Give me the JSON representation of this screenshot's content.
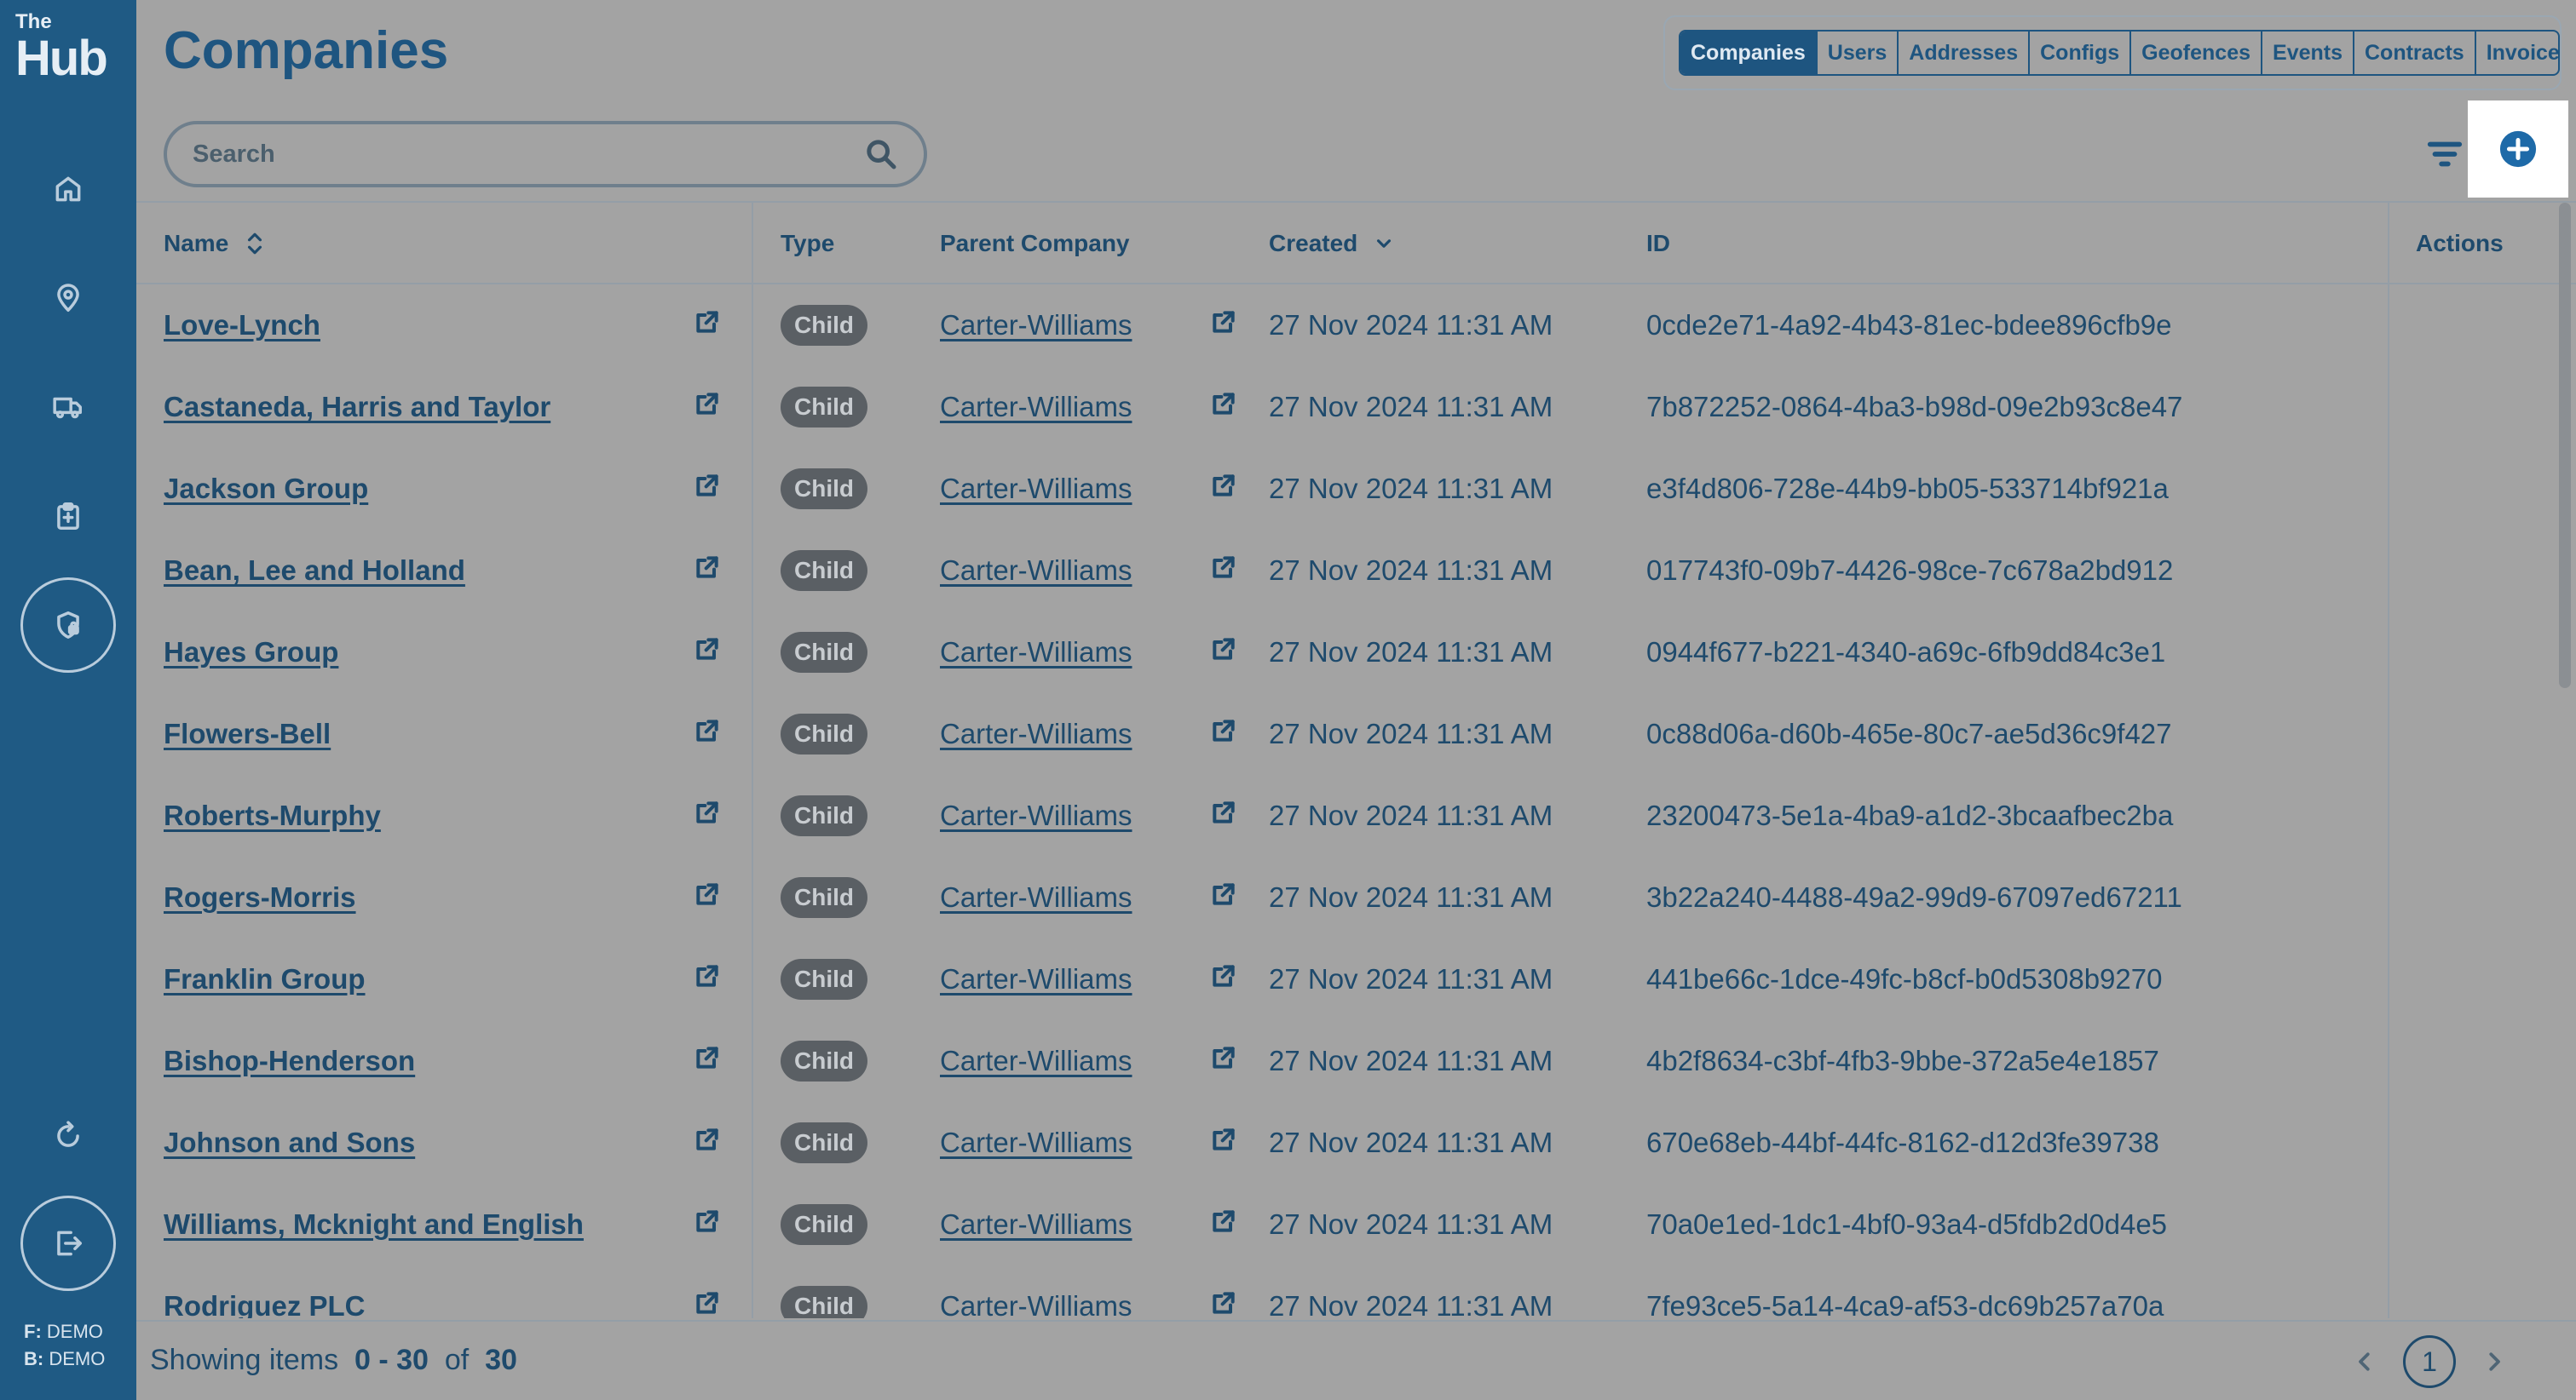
{
  "app": {
    "logo_small": "The",
    "logo_large": "Hub"
  },
  "sidebar": {
    "icons": [
      "home-icon",
      "location-pin-icon",
      "truck-icon",
      "clipboard-icon",
      "shield-lock-icon",
      "refresh-icon",
      "logout-icon"
    ],
    "env_f_label": "F:",
    "env_f_value": "DEMO",
    "env_b_label": "B:",
    "env_b_value": "DEMO"
  },
  "page": {
    "title": "Companies"
  },
  "tabs": [
    "Companies",
    "Users",
    "Addresses",
    "Configs",
    "Geofences",
    "Events",
    "Contracts",
    "Invoices"
  ],
  "active_tab": "Companies",
  "search": {
    "placeholder": "Search",
    "value": ""
  },
  "table": {
    "headers": {
      "name": "Name",
      "type": "Type",
      "parent": "Parent Company",
      "created": "Created",
      "id": "ID",
      "actions": "Actions"
    },
    "rows": [
      {
        "name": "Love-Lynch",
        "type": "Child",
        "parent": "Carter-Williams",
        "created": "27 Nov 2024 11:31 AM",
        "id": "0cde2e71-4a92-4b43-81ec-bdee896cfb9e"
      },
      {
        "name": "Castaneda, Harris and Taylor",
        "type": "Child",
        "parent": "Carter-Williams",
        "created": "27 Nov 2024 11:31 AM",
        "id": "7b872252-0864-4ba3-b98d-09e2b93c8e47"
      },
      {
        "name": "Jackson Group",
        "type": "Child",
        "parent": "Carter-Williams",
        "created": "27 Nov 2024 11:31 AM",
        "id": "e3f4d806-728e-44b9-bb05-533714bf921a"
      },
      {
        "name": "Bean, Lee and Holland",
        "type": "Child",
        "parent": "Carter-Williams",
        "created": "27 Nov 2024 11:31 AM",
        "id": "017743f0-09b7-4426-98ce-7c678a2bd912"
      },
      {
        "name": "Hayes Group",
        "type": "Child",
        "parent": "Carter-Williams",
        "created": "27 Nov 2024 11:31 AM",
        "id": "0944f677-b221-4340-a69c-6fb9dd84c3e1"
      },
      {
        "name": "Flowers-Bell",
        "type": "Child",
        "parent": "Carter-Williams",
        "created": "27 Nov 2024 11:31 AM",
        "id": "0c88d06a-d60b-465e-80c7-ae5d36c9f427"
      },
      {
        "name": "Roberts-Murphy",
        "type": "Child",
        "parent": "Carter-Williams",
        "created": "27 Nov 2024 11:31 AM",
        "id": "23200473-5e1a-4ba9-a1d2-3bcaafbec2ba"
      },
      {
        "name": "Rogers-Morris",
        "type": "Child",
        "parent": "Carter-Williams",
        "created": "27 Nov 2024 11:31 AM",
        "id": "3b22a240-4488-49a2-99d9-67097ed67211"
      },
      {
        "name": "Franklin Group",
        "type": "Child",
        "parent": "Carter-Williams",
        "created": "27 Nov 2024 11:31 AM",
        "id": "441be66c-1dce-49fc-b8cf-b0d5308b9270"
      },
      {
        "name": "Bishop-Henderson",
        "type": "Child",
        "parent": "Carter-Williams",
        "created": "27 Nov 2024 11:31 AM",
        "id": "4b2f8634-c3bf-4fb3-9bbe-372a5e4e1857"
      },
      {
        "name": "Johnson and Sons",
        "type": "Child",
        "parent": "Carter-Williams",
        "created": "27 Nov 2024 11:31 AM",
        "id": "670e68eb-44bf-44fc-8162-d12d3fe39738"
      },
      {
        "name": "Williams, Mcknight and English",
        "type": "Child",
        "parent": "Carter-Williams",
        "created": "27 Nov 2024 11:31 AM",
        "id": "70a0e1ed-1dc1-4bf0-93a4-d5fdb2d0d4e5"
      },
      {
        "name": "Rodriguez PLC",
        "type": "Child",
        "parent": "Carter-Williams",
        "created": "27 Nov 2024 11:31 AM",
        "id": "7fe93ce5-5a14-4ca9-af53-dc69b257a70a"
      }
    ]
  },
  "footer": {
    "showing_label": "Showing items",
    "range": "0 - 30",
    "of_label": "of",
    "total": "30",
    "current_page": "1"
  },
  "colors": {
    "sidebar": "#1f5a84",
    "accent": "#1e5580",
    "overlay_bg": "#a3a3a3"
  }
}
